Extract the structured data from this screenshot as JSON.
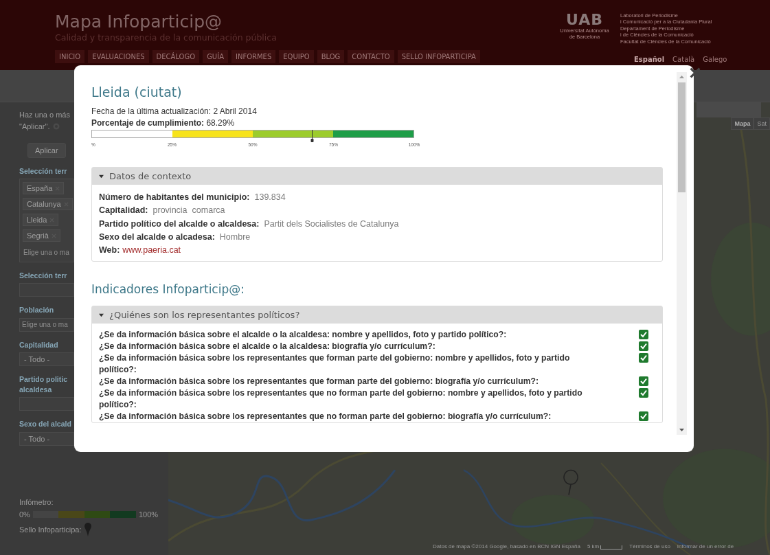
{
  "header": {
    "title": "Mapa Infoparticip@",
    "subtitle": "Calidad y transparencia de la comunicación pública",
    "nav": [
      "INICIO",
      "EVALUACIONES",
      "DECÁLOGO",
      "GUÍA",
      "INFORMES",
      "EQUIPO",
      "BLOG",
      "CONTACTO",
      "SELLO INFOPARTICIPA"
    ],
    "logo": {
      "mark": "UAB",
      "caption": [
        "Universitat Autònoma",
        "de Barcelona"
      ]
    },
    "institution_lines": [
      "Laboratori de Periodisme",
      "i Comunicació per a la Ciutadania Plural",
      "Departament de Periodisme",
      "i de Ciències de la Comunicació",
      "Facultat de Ciències de la Comunicació"
    ],
    "languages": [
      {
        "label": "Español",
        "selected": true
      },
      {
        "label": "Català",
        "selected": false
      },
      {
        "label": "Galego",
        "selected": false
      }
    ]
  },
  "sidebar": {
    "intro": [
      "Haz una o más",
      "\"Aplicar\"."
    ],
    "apply_button": "Aplicar",
    "filters": [
      {
        "kind": "tags",
        "label": [
          "Selección terr"
        ],
        "tags": [
          "España",
          "Catalunya",
          "Lleida",
          "Segrià"
        ],
        "placeholder": "Elige una o ma"
      },
      {
        "kind": "input",
        "label": [
          "Selección terr"
        ]
      },
      {
        "kind": "input",
        "label": [
          "Población"
        ],
        "placeholder": "Elige una o ma"
      },
      {
        "kind": "select",
        "label": [
          "Capitalidad"
        ],
        "value": "- Todo -"
      },
      {
        "kind": "input",
        "label": [
          "Partido politic",
          "alcaldesa"
        ]
      },
      {
        "kind": "select",
        "label": [
          "Sexo del alcald"
        ],
        "value": "- Todo -"
      }
    ],
    "infometro": {
      "label": "Infómetro:",
      "min": "0%",
      "max": "100%"
    },
    "seal_label": "Sello Infoparticipa:"
  },
  "map": {
    "kind": "picture",
    "type_buttons": [
      {
        "label": "Mapa",
        "selected": true
      },
      {
        "label": "Sat",
        "selected": false
      }
    ],
    "attribution": "Datos de mapa ©2014 Google, basado en BCN IGN España",
    "scale": "5 km",
    "terms": "Términos de uso",
    "report": "Informar de un error de"
  },
  "modal": {
    "title": "Lleida (ciutat)",
    "updated": "Fecha de la última actualización: 2 Abril 2014",
    "compliance_label": "Porcentaje de cumplimiento:",
    "compliance_value": "68.29%",
    "meter": {
      "level": 0.6829,
      "ticks": [
        "%",
        "25%",
        "50%",
        "75%",
        "100%"
      ]
    },
    "context": {
      "heading": "Datos de contexto",
      "expanded": true,
      "fields": [
        {
          "kind": "text",
          "label": "Número de habitantes del municipio:",
          "values": [
            "139.834"
          ]
        },
        {
          "kind": "text",
          "label": "Capitalidad:",
          "values": [
            "provincia",
            "comarca"
          ]
        },
        {
          "kind": "text",
          "label": "Partido político del alcalde o alcaldesa:",
          "values": [
            "Partit dels Socialistes de Catalunya"
          ]
        },
        {
          "kind": "text",
          "label": "Sexo del alcalde o alcadesa:",
          "values": [
            "Hombre"
          ]
        },
        {
          "kind": "link",
          "label": "Web:",
          "values": [
            "www.paeria.cat"
          ]
        }
      ]
    },
    "indicators_title": "Indicadores Infoparticip@:",
    "sections": [
      {
        "heading": "¿Quiénes son los representantes políticos?",
        "expanded": true,
        "items": [
          {
            "text": "¿Se da información básica sobre el alcalde o la alcaldesa: nombre y apellidos, foto y partido político?:",
            "checked": true
          },
          {
            "text": "¿Se da información básica sobre el alcalde o la alcaldesa: biografía y/o currículum?:",
            "checked": true
          },
          {
            "text": "¿Se da información básica sobre los representantes que forman parte del gobierno: nombre y apellidos, foto y partido político?:",
            "checked": true
          },
          {
            "text": "¿Se da información básica sobre los representantes que forman parte del gobierno: biografía y/o currículum?:",
            "checked": true
          },
          {
            "text": "¿Se da información básica sobre los representantes que no forman parte del gobierno: nombre y apellidos, foto y partido político?:",
            "checked": true
          },
          {
            "text": "¿Se da información básica sobre los representantes que no forman parte del gobierno: biografía y/o currículum?:",
            "checked": true
          }
        ]
      }
    ]
  }
}
